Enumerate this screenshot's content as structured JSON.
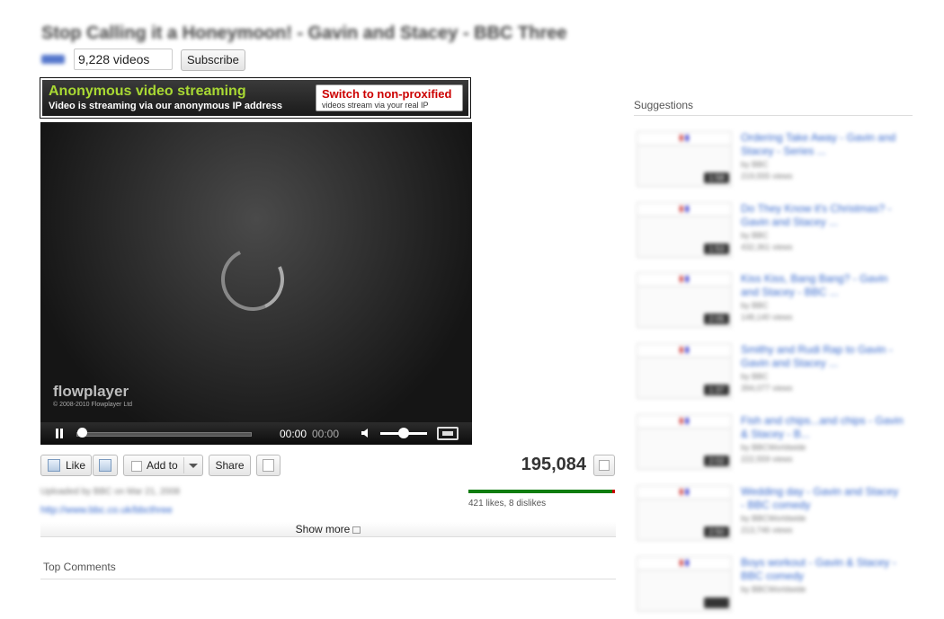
{
  "header": {
    "title": "Stop Calling it a Honeymoon! - Gavin and Stacey - BBC Three",
    "video_count": "9,228 videos",
    "subscribe_label": "Subscribe"
  },
  "proxy_banner": {
    "title": "Anonymous video streaming",
    "subtitle": "Video is streaming via our anonymous IP address",
    "switch_title": "Switch to non-proxified",
    "switch_subtitle": "videos stream via your real IP"
  },
  "player": {
    "brand": "flowplayer",
    "copyright": "© 2008-2010 Flowplayer Ltd",
    "time_current": "00:00",
    "time_total": "00:00"
  },
  "actions": {
    "like_label": "Like",
    "addto_label": "Add to",
    "share_label": "Share",
    "view_count": "195,084",
    "likes_text": "421 likes, 8 dislikes",
    "like_ratio": 0.98
  },
  "details": {
    "uploaded": "Uploaded by BBC on Mar 21, 2008",
    "link": "http://www.bbc.co.uk/bbcthree",
    "show_more": "Show more"
  },
  "comments": {
    "heading": "Top Comments"
  },
  "suggestions": {
    "heading": "Suggestions",
    "items": [
      {
        "title": "Ordering Take Away - Gavin and Stacey - Series ...",
        "by": "by BBC",
        "views": "219,555 views",
        "duration": "1:58"
      },
      {
        "title": "Do They Know it's Christmas? - Gavin and Stacey ...",
        "by": "by BBC",
        "views": "432,361 views",
        "duration": "1:53"
      },
      {
        "title": "Kiss Kiss, Bang Bang? - Gavin and Stacey - BBC ...",
        "by": "by BBC",
        "views": "148,140 views",
        "duration": "2:05"
      },
      {
        "title": "Smithy and Rudi Rap to Gavin - Gavin and Stacey ...",
        "by": "by BBC",
        "views": "394,077 views",
        "duration": "1:37"
      },
      {
        "title": "Fish and chips...and chips - Gavin & Stacey - B...",
        "by": "by BBCWorldwide",
        "views": "222,559 views",
        "duration": "2:02"
      },
      {
        "title": "Wedding day - Gavin and Stacey - BBC comedy",
        "by": "by BBCWorldwide",
        "views": "213,746 views",
        "duration": "2:50"
      },
      {
        "title": "Boys workout - Gavin & Stacey - BBC comedy",
        "by": "by BBCWorldwide",
        "views": "",
        "duration": ""
      }
    ]
  },
  "colors": {
    "accent_green": "#a8d833",
    "alert_red": "#cc0000",
    "link_blue": "#3366cc",
    "like_green": "#0f7d0f"
  }
}
